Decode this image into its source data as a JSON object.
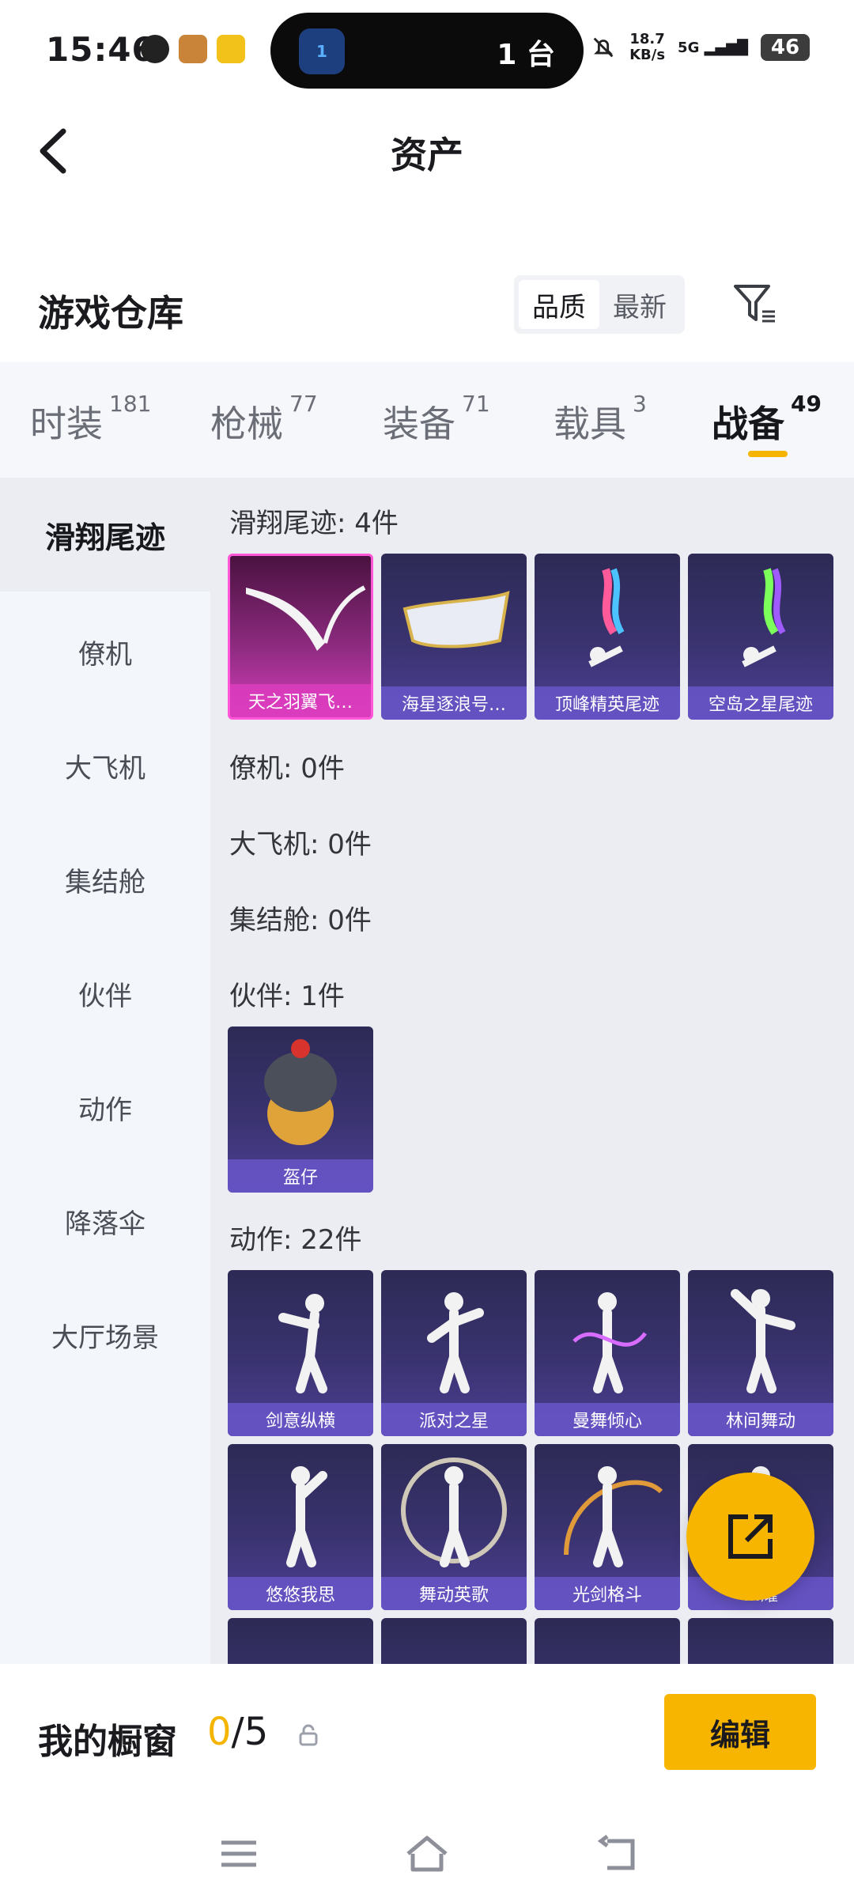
{
  "status_bar": {
    "time": "15:46",
    "island_text": "1 台",
    "island_badge": "1",
    "net_speed_value": "18.7",
    "net_speed_unit": "KB/s",
    "signal_label": "5G",
    "battery": "46"
  },
  "header": {
    "title": "资产"
  },
  "warehouse": {
    "title": "游戏仓库",
    "sort_options": [
      "品质",
      "最新"
    ],
    "sort_active": "品质"
  },
  "tabs": [
    {
      "label": "时装",
      "count": "181"
    },
    {
      "label": "枪械",
      "count": "77"
    },
    {
      "label": "装备",
      "count": "71"
    },
    {
      "label": "载具",
      "count": "3"
    },
    {
      "label": "战备",
      "count": "49"
    }
  ],
  "sidenav": [
    "滑翔尾迹",
    "僚机",
    "大飞机",
    "集结舱",
    "伙伴",
    "动作",
    "降落伞",
    "大厅场景"
  ],
  "groups": {
    "glide": {
      "label": "滑翔尾迹: 4件",
      "items": [
        "天之羽翼飞…",
        "海星逐浪号…",
        "顶峰精英尾迹",
        "空岛之星尾迹"
      ]
    },
    "wingman": {
      "label": "僚机: 0件"
    },
    "plane": {
      "label": "大飞机: 0件"
    },
    "pod": {
      "label": "集结舱: 0件"
    },
    "partner": {
      "label": "伙伴: 1件",
      "items": [
        "盔仔"
      ]
    },
    "emote": {
      "label": "动作: 22件",
      "items": [
        "剑意纵横",
        "派对之星",
        "曼舞倾心",
        "林间舞动",
        "悠悠我思",
        "舞动英歌",
        "光剑格斗",
        "…耀"
      ]
    }
  },
  "showcase": {
    "title": "我的橱窗",
    "current": "0",
    "total": "/5",
    "edit_label": "编辑"
  },
  "colors": {
    "accent": "#f5b400",
    "card_bg": "#3a3370",
    "rare_card": "#d23fba"
  }
}
